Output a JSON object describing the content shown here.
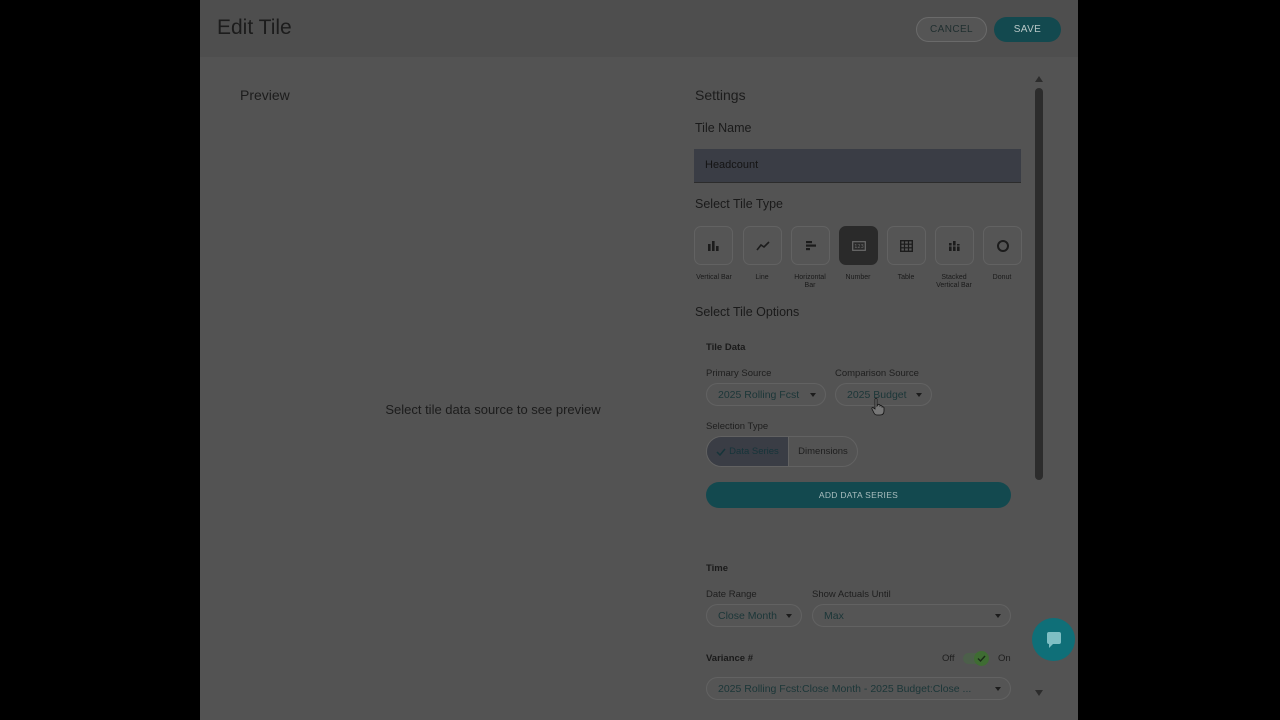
{
  "dialog": {
    "title": "Edit Tile",
    "cancel_label": "CANCEL",
    "save_label": "SAVE"
  },
  "preview": {
    "title": "Preview",
    "empty_message": "Select tile data source to see preview"
  },
  "settings": {
    "title": "Settings",
    "tile_name_label": "Tile Name",
    "tile_name_value": "Headcount",
    "tile_type_label": "Select Tile Type",
    "tile_types": [
      {
        "label": "Vertical Bar",
        "icon": "vertical-bar-icon",
        "active": false
      },
      {
        "label": "Line",
        "icon": "line-chart-icon",
        "active": false
      },
      {
        "label": "Horizontal Bar",
        "icon": "horizontal-bar-icon",
        "active": false
      },
      {
        "label": "Number",
        "icon": "number-icon",
        "active": true
      },
      {
        "label": "Table",
        "icon": "table-icon",
        "active": false
      },
      {
        "label": "Stacked Vertical Bar",
        "icon": "stacked-bar-icon",
        "active": false
      },
      {
        "label": "Donut",
        "icon": "donut-icon",
        "active": false
      }
    ],
    "tile_options_label": "Select Tile Options",
    "tile_data": {
      "title": "Tile Data",
      "primary_source_label": "Primary Source",
      "primary_source_value": "2025 Rolling Fcst",
      "comparison_source_label": "Comparison Source",
      "comparison_source_value": "2025 Budget",
      "selection_type_label": "Selection Type",
      "selection_options": [
        "Data Series",
        "Dimensions"
      ],
      "add_series_label": "ADD DATA SERIES"
    },
    "time": {
      "title": "Time",
      "date_range_label": "Date Range",
      "date_range_value": "Close Month",
      "show_actuals_label": "Show Actuals Until",
      "show_actuals_value": "Max"
    },
    "variance": {
      "label": "Variance #",
      "toggle_off_label": "Off",
      "toggle_on_label": "On",
      "value": "2025 Rolling Fcst:Close Month - 2025 Budget:Close ..."
    }
  },
  "colors": {
    "accent": "#13494f",
    "chat": "#0f6f78"
  }
}
